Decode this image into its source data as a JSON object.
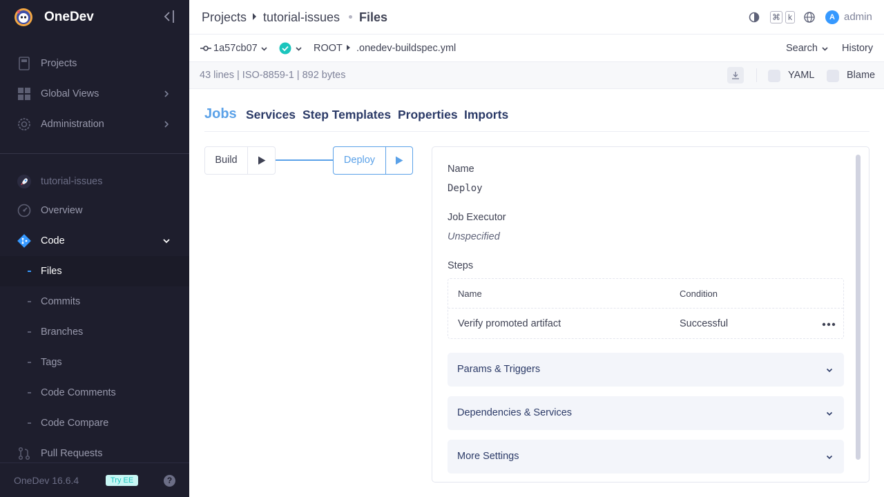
{
  "brand": {
    "name": "OneDev"
  },
  "sidebar": {
    "global_items": [
      {
        "label": "Projects",
        "icon": "book-icon"
      },
      {
        "label": "Global Views",
        "icon": "grid-icon"
      },
      {
        "label": "Administration",
        "icon": "gear-icon"
      }
    ],
    "project": {
      "name": "tutorial-issues",
      "icon": "rocket-icon"
    },
    "project_items": {
      "overview": "Overview",
      "code": "Code",
      "pull_requests": "Pull Requests"
    },
    "code_subitems": [
      "Files",
      "Commits",
      "Branches",
      "Tags",
      "Code Comments",
      "Code Compare"
    ],
    "active_subitem": "Files",
    "footer": {
      "version": "OneDev 16.6.4",
      "try_ee": "Try EE",
      "help": "?"
    }
  },
  "topbar": {
    "breadcrumb": [
      "Projects",
      "tutorial-issues",
      "Files"
    ],
    "kbd": [
      "⌘",
      "k"
    ],
    "avatar_letter": "A",
    "user": "admin"
  },
  "revbar": {
    "commit": "1a57cb07",
    "path_root": "ROOT",
    "path_file": ".onedev-buildspec.yml",
    "search": "Search",
    "history": "History"
  },
  "infobar": {
    "file_info": "43 lines | ISO-8859-1 | 892 bytes",
    "yaml_label": "YAML",
    "blame_label": "Blame"
  },
  "tabs": [
    "Jobs",
    "Services",
    "Step Templates",
    "Properties",
    "Imports"
  ],
  "active_tab": "Jobs",
  "jobs": [
    {
      "name": "Build"
    },
    {
      "name": "Deploy",
      "selected": true
    }
  ],
  "detail": {
    "name_label": "Name",
    "name_value": "Deploy",
    "executor_label": "Job Executor",
    "executor_value": "Unspecified",
    "steps_label": "Steps",
    "steps_columns": [
      "Name",
      "Condition"
    ],
    "steps": [
      {
        "name": "Verify promoted artifact",
        "condition": "Successful"
      }
    ],
    "sections": [
      "Params & Triggers",
      "Dependencies & Services",
      "More Settings"
    ]
  },
  "colors": {
    "accent": "#3699ff",
    "sidebar_bg": "#1e1e2d",
    "success": "#1bc5bd"
  }
}
